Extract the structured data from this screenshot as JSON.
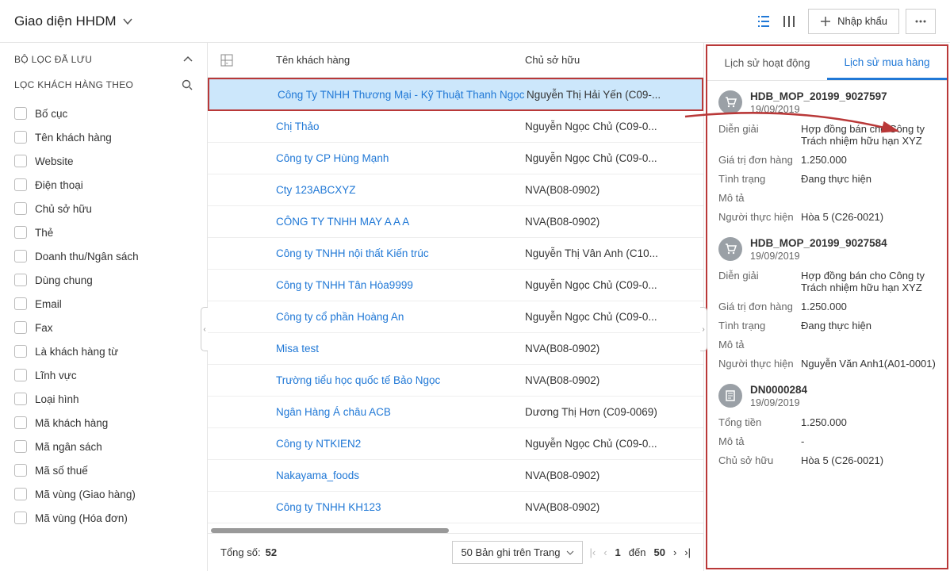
{
  "header": {
    "title": "Giao diện HHDM",
    "import_btn": "Nhập khẩu"
  },
  "sidebar": {
    "saved_filters": "BỘ LỌC ĐÃ LƯU",
    "filter_by": "LỌC KHÁCH HÀNG THEO",
    "items": [
      "Bố cục",
      "Tên khách hàng",
      "Website",
      "Điện thoại",
      "Chủ sở hữu",
      "Thẻ",
      "Doanh thu/Ngân sách",
      "Dùng chung",
      "Email",
      "Fax",
      "Là khách hàng từ",
      "Lĩnh vực",
      "Loại hình",
      "Mã khách hàng",
      "Mã ngân sách",
      "Mã số thuế",
      "Mã vùng (Giao hàng)",
      "Mã vùng (Hóa đơn)"
    ]
  },
  "grid": {
    "col_name": "Tên khách hàng",
    "col_owner": "Chủ sở hữu",
    "rows": [
      {
        "name": "Công Ty TNHH Thương Mại - Kỹ Thuật Thanh Ngọc",
        "owner": "Nguyễn Thị Hải Yến (C09-...",
        "selected": true
      },
      {
        "name": "Chị Thảo",
        "owner": "Nguyễn Ngọc Chủ (C09-0..."
      },
      {
        "name": "Công ty CP Hùng Mạnh",
        "owner": "Nguyễn Ngọc Chủ (C09-0..."
      },
      {
        "name": "Cty 123ABCXYZ",
        "owner": "NVA(B08-0902)"
      },
      {
        "name": "CÔNG TY TNHH MAY A A A",
        "owner": "NVA(B08-0902)"
      },
      {
        "name": "Công ty TNHH nội thất Kiến trúc",
        "owner": "Nguyễn Thị Vân Anh (C10..."
      },
      {
        "name": "Công ty TNHH Tân Hòa9999",
        "owner": "Nguyễn Ngọc Chủ (C09-0..."
      },
      {
        "name": "Công ty cổ phần Hoàng An",
        "owner": "Nguyễn Ngọc Chủ (C09-0..."
      },
      {
        "name": "Misa test",
        "owner": "NVA(B08-0902)"
      },
      {
        "name": "Trường tiểu học quốc tế Bảo Ngọc",
        "owner": "NVA(B08-0902)"
      },
      {
        "name": "Ngân Hàng Á châu ACB",
        "owner": "Dương Thị Hơn (C09-0069)"
      },
      {
        "name": "Công ty NTKIEN2",
        "owner": "Nguyễn Ngọc Chủ (C09-0..."
      },
      {
        "name": "Nakayama_foods",
        "owner": "NVA(B08-0902)"
      },
      {
        "name": "Công ty TNHH KH123",
        "owner": "NVA(B08-0902)"
      }
    ],
    "footer": {
      "total_label": "Tổng số:",
      "total": "52",
      "pagesize": "50 Bản ghi trên Trang",
      "from": "1",
      "to_text": "đến",
      "to": "50"
    }
  },
  "detail": {
    "tab1": "Lịch sử hoạt động",
    "tab2": "Lịch sử mua hàng",
    "labels": {
      "dien_giai": "Diễn giải",
      "gia_tri": "Giá trị đơn hàng",
      "tinh_trang": "Tình trạng",
      "mo_ta": "Mô tả",
      "nguoi_th": "Người thực hiện",
      "tong_tien": "Tổng tiền",
      "chu_so_huu": "Chủ sở hữu"
    },
    "records": [
      {
        "icon": "cart",
        "title": "HDB_MOP_20199_9027597",
        "date": "19/09/2019",
        "kv": [
          {
            "k": "dien_giai",
            "v": "Hợp đồng bán cho Công ty Trách nhiệm hữu hạn XYZ"
          },
          {
            "k": "gia_tri",
            "v": "1.250.000"
          },
          {
            "k": "tinh_trang",
            "v": "Đang thực hiện"
          },
          {
            "k": "mo_ta",
            "v": ""
          },
          {
            "k": "nguoi_th",
            "v": "Hòa 5 (C26-0021)"
          }
        ]
      },
      {
        "icon": "cart",
        "title": "HDB_MOP_20199_9027584",
        "date": "19/09/2019",
        "kv": [
          {
            "k": "dien_giai",
            "v": "Hợp đồng bán cho Công ty Trách nhiệm hữu hạn XYZ"
          },
          {
            "k": "gia_tri",
            "v": "1.250.000"
          },
          {
            "k": "tinh_trang",
            "v": "Đang thực hiện"
          },
          {
            "k": "mo_ta",
            "v": ""
          },
          {
            "k": "nguoi_th",
            "v": "Nguyễn Văn Anh1(A01-0001)"
          }
        ]
      },
      {
        "icon": "doc",
        "title": "DN0000284",
        "date": "19/09/2019",
        "kv": [
          {
            "k": "tong_tien",
            "v": "1.250.000"
          },
          {
            "k": "mo_ta",
            "v": "-"
          },
          {
            "k": "chu_so_huu",
            "v": "Hòa 5 (C26-0021)"
          }
        ]
      }
    ]
  }
}
